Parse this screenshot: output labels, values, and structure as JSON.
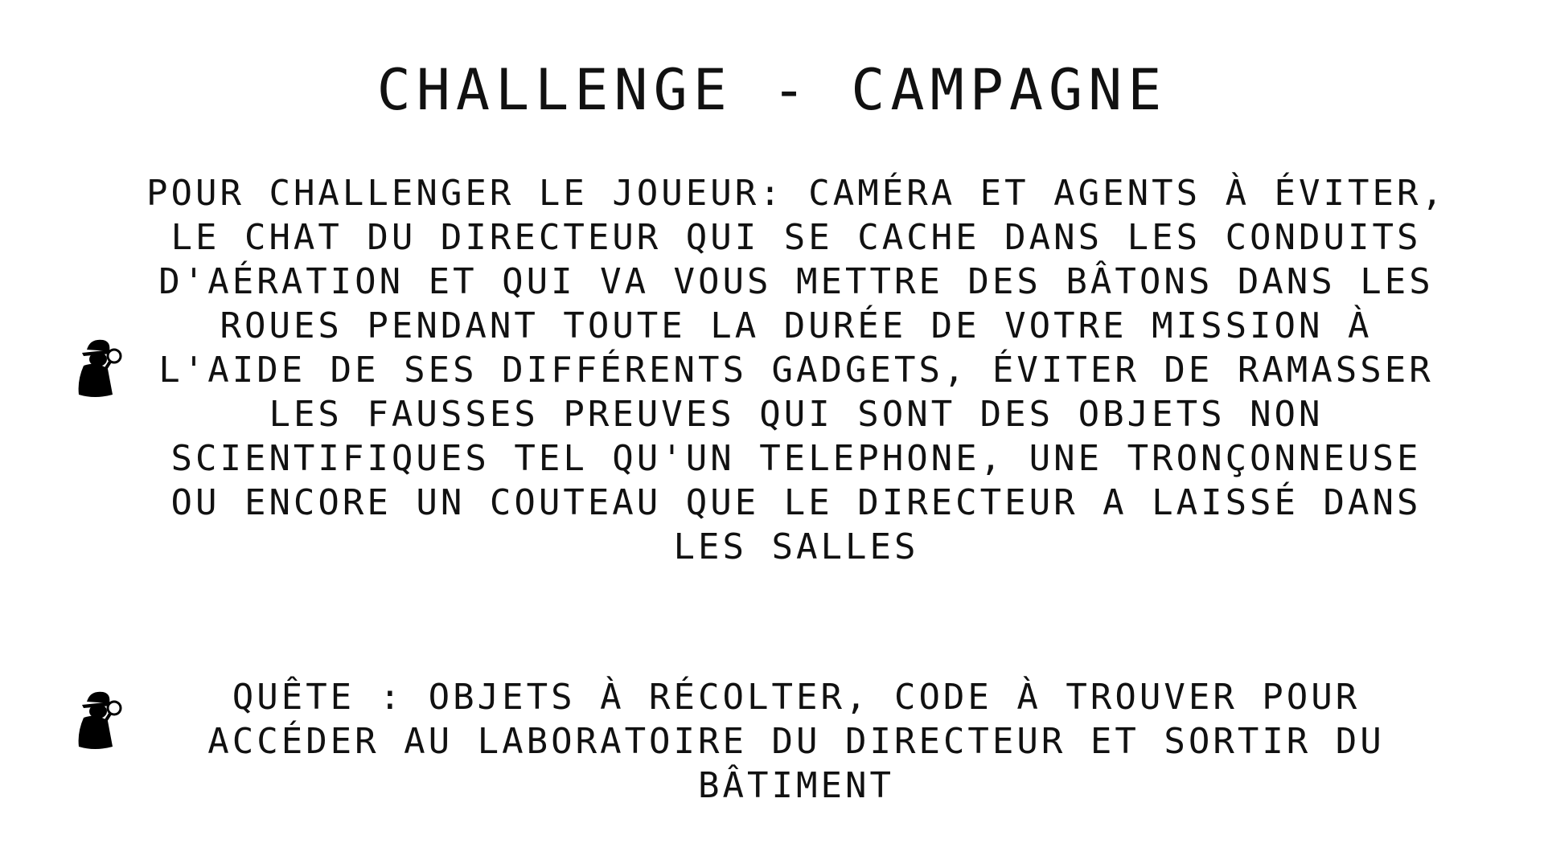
{
  "slide": {
    "title": "CHALLENGE - CAMPAGNE",
    "items": [
      {
        "icon": "detective-magnifier-icon",
        "text": "POUR CHALLENGER LE JOUEUR: CAMÉRA ET AGENTS À ÉVITER, LE CHAT DU DIRECTEUR QUI SE CACHE DANS LES CONDUITS D'AÉRATION ET QUI VA VOUS METTRE DES BÂTONS DANS LES ROUES PENDANT TOUTE LA DURÉE DE VOTRE MISSION À L'AIDE DE SES DIFFÉRENTS GADGETS, ÉVITER DE RAMASSER LES FAUSSES PREUVES QUI SONT DES OBJETS NON SCIENTIFIQUES TEL QU'UN TELEPHONE, UNE TRONÇONNEUSE OU ENCORE UN COUTEAU QUE LE DIRECTEUR A LAISSÉ DANS LES SALLES"
      },
      {
        "icon": "detective-magnifier-icon",
        "text": "QUÊTE : OBJETS À RÉCOLTER,  CODE À TROUVER POUR ACCÉDER AU LABORATOIRE DU DIRECTEUR ET SORTIR DU BÂTIMENT"
      }
    ]
  }
}
